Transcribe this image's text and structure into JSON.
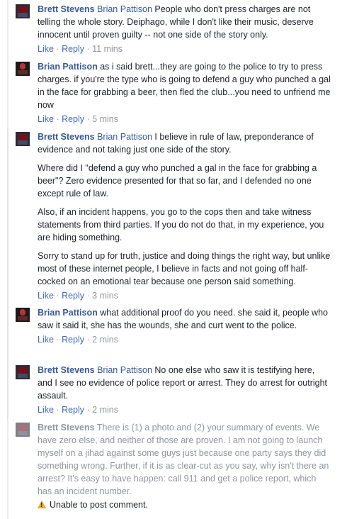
{
  "comments": [
    {
      "author": "Brett Stevens",
      "mention": "Brian Pattison",
      "paragraphs": [
        "People who don't press charges are not telling the whole story. Deiphago, while I don't like their music, deserve innocent until proven guilty -- not one side of the story only."
      ],
      "actions": {
        "like": "Like",
        "reply": "Reply",
        "time": "11 mins"
      }
    },
    {
      "author": "Brian Pattison",
      "paragraphs": [
        "as i said brett...they are going to the police to try to press charges. if you're the type who is going to defend a guy who punched a gal in the face for grabbing a beer, then fled the club...you need to unfriend me now"
      ],
      "actions": {
        "like": "Like",
        "reply": "Reply",
        "time": "5 mins"
      }
    },
    {
      "author": "Brett Stevens",
      "mention": "Brian Pattison",
      "paragraphs": [
        "I believe in rule of law, preponderance of evidence and not taking just one side of the story.",
        "Where did I \"defend a guy who punched a gal in the face for grabbing a beer\"? Zero evidence presented for that so far, and I defended no one except rule of law.",
        "Also, if an incident happens, you go to the cops then and take witness statements from third parties. If you do not do that, in my experience, you are hiding something.",
        "Sorry to stand up for truth, justice and doing things the right way, but unlike most of these internet people, I believe in facts and not going off half-cocked on an emotional tear because one person said something."
      ],
      "actions": {
        "like": "Like",
        "reply": "Reply",
        "time": "3 mins"
      }
    },
    {
      "author": "Brian Pattison",
      "paragraphs": [
        "what additional proof do you need. she said it, people who saw it said it, she has the wounds, she and curt went to the police."
      ],
      "actions": {
        "like": "Like",
        "reply": "Reply",
        "time": "2 mins"
      }
    },
    {
      "author": "Brett Stevens",
      "mention": "Brian Pattison",
      "paragraphs": [
        "No one else who saw it is testifying here, and I see no evidence of police report or arrest. They do arrest for outright assault."
      ],
      "actions": {
        "like": "Like",
        "reply": "Reply",
        "time": "2 mins"
      }
    },
    {
      "author": "Brett Stevens",
      "paragraphs": [
        "There is (1) a photo and (2) your summary of events. We have zero else, and neither of those are proven. I am not going to launch myself on a jihad against some guys just because one party says they did something wrong. Further, if it is as clear-cut as you say, why isn't there an arrest? It's easy to have happen: call 911 and get a police report, which has an incident number."
      ],
      "error": "Unable to post comment."
    }
  ],
  "colors": {
    "link": "#365899",
    "action": "#4267b2",
    "meta": "#90949c",
    "warning": "#f5a623"
  },
  "icons": {
    "warning": "warning-triangle-icon"
  }
}
